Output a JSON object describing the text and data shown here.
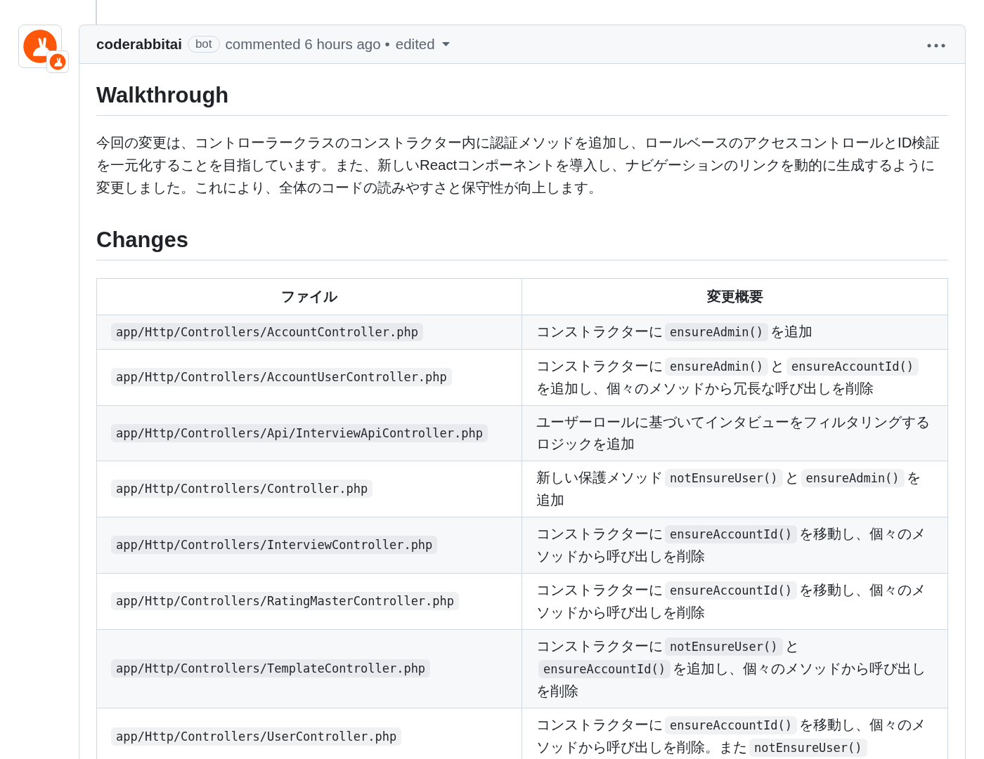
{
  "comment": {
    "author": "coderabbitai",
    "author_badge": "bot",
    "timestamp": "commented 6 hours ago",
    "separator": "•",
    "edited_label": "edited"
  },
  "walkthrough": {
    "heading": "Walkthrough",
    "text": "今回の変更は、コントローラークラスのコンストラクター内に認証メソッドを追加し、ロールベースのアクセスコントロールとID検証を一元化することを目指しています。また、新しいReactコンポーネントを導入し、ナビゲーションのリンクを動的に生成するように変更しました。これにより、全体のコードの読みやすさと保守性が向上します。"
  },
  "changes": {
    "heading": "Changes",
    "columns": [
      "ファイル",
      "変更概要"
    ],
    "rows": [
      {
        "file": "app/Http/Controllers/AccountController.php",
        "summary": [
          {
            "kind": "text",
            "text": "コンストラクターに"
          },
          {
            "kind": "code",
            "text": "ensureAdmin()"
          },
          {
            "kind": "text",
            "text": "を追加"
          }
        ]
      },
      {
        "file": "app/Http/Controllers/AccountUserController.php",
        "summary": [
          {
            "kind": "text",
            "text": "コンストラクターに"
          },
          {
            "kind": "code",
            "text": "ensureAdmin()"
          },
          {
            "kind": "text",
            "text": "と"
          },
          {
            "kind": "code",
            "text": "ensureAccountId()"
          },
          {
            "kind": "text",
            "text": "を追加し、個々のメソッドから冗長な呼び出しを削除"
          }
        ]
      },
      {
        "file": "app/Http/Controllers/Api/InterviewApiController.php",
        "summary": [
          {
            "kind": "text",
            "text": "ユーザーロールに基づいてインタビューをフィルタリングするロジックを追加"
          }
        ]
      },
      {
        "file": "app/Http/Controllers/Controller.php",
        "summary": [
          {
            "kind": "text",
            "text": "新しい保護メソッド"
          },
          {
            "kind": "code",
            "text": "notEnsureUser()"
          },
          {
            "kind": "text",
            "text": "と"
          },
          {
            "kind": "code",
            "text": "ensureAdmin()"
          },
          {
            "kind": "text",
            "text": "を追加"
          }
        ]
      },
      {
        "file": "app/Http/Controllers/InterviewController.php",
        "summary": [
          {
            "kind": "text",
            "text": "コンストラクターに"
          },
          {
            "kind": "code",
            "text": "ensureAccountId()"
          },
          {
            "kind": "text",
            "text": "を移動し、個々のメソッドから呼び出しを削除"
          }
        ]
      },
      {
        "file": "app/Http/Controllers/RatingMasterController.php",
        "summary": [
          {
            "kind": "text",
            "text": "コンストラクターに"
          },
          {
            "kind": "code",
            "text": "ensureAccountId()"
          },
          {
            "kind": "text",
            "text": "を移動し、個々のメソッドから呼び出しを削除"
          }
        ]
      },
      {
        "file": "app/Http/Controllers/TemplateController.php",
        "summary": [
          {
            "kind": "text",
            "text": "コンストラクターに"
          },
          {
            "kind": "code",
            "text": "notEnsureUser()"
          },
          {
            "kind": "text",
            "text": "と"
          },
          {
            "kind": "code",
            "text": "ensureAccountId()"
          },
          {
            "kind": "text",
            "text": "を追加し、個々のメソッドから呼び出しを削除"
          }
        ]
      },
      {
        "file": "app/Http/Controllers/UserController.php",
        "summary": [
          {
            "kind": "text",
            "text": "コンストラクターに"
          },
          {
            "kind": "code",
            "text": "ensureAccountId()"
          },
          {
            "kind": "text",
            "text": "を移動し、個々のメソッドから呼び出しを削除。また"
          },
          {
            "kind": "code",
            "text": "notEnsureUser()"
          }
        ]
      }
    ]
  }
}
